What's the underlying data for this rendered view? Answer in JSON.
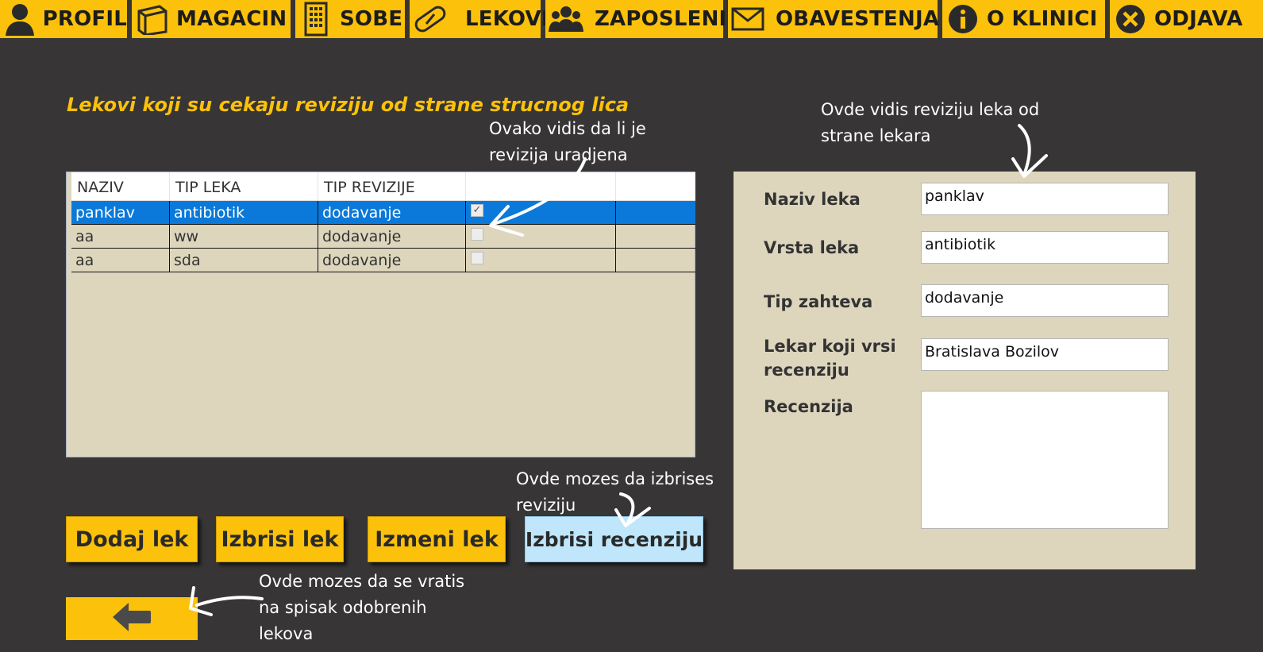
{
  "nav": {
    "items": [
      {
        "label": "PROFIL",
        "icon": "person-icon"
      },
      {
        "label": "MAGACIN",
        "icon": "box-icon"
      },
      {
        "label": "SOBE",
        "icon": "building-icon"
      },
      {
        "label": "LEKOVI",
        "icon": "pill-icon"
      },
      {
        "label": "ZAPOSLENI",
        "icon": "people-icon"
      },
      {
        "label": "OBAVESTENJA",
        "icon": "envelope-icon"
      },
      {
        "label": "O KLINICI",
        "icon": "info-icon"
      },
      {
        "label": "ODJAVA",
        "icon": "close-circle-icon"
      }
    ],
    "accent": "#fcc10a"
  },
  "main": {
    "title": "Lekovi koji su cekaju reviziju od strane strucnog lica"
  },
  "table": {
    "columns": [
      "NAZIV",
      "TIP LEKA",
      "TIP REVIZIJE",
      ""
    ],
    "rows": [
      {
        "naziv": "panklav",
        "tip_leka": "antibiotik",
        "tip_revizije": "dodavanje",
        "checked": true,
        "selected": true
      },
      {
        "naziv": "aa",
        "tip_leka": "ww",
        "tip_revizije": "dodavanje",
        "checked": false,
        "selected": false
      },
      {
        "naziv": "aa",
        "tip_leka": "sda",
        "tip_revizije": "dodavanje",
        "checked": false,
        "selected": false
      }
    ],
    "selection_color": "#0a79d9"
  },
  "buttons": {
    "add": "Dodaj lek",
    "delete": "Izbrisi lek",
    "edit": "Izmeni lek",
    "delete_review": "Izbrisi recenziju"
  },
  "details": {
    "naziv_label": "Naziv leka",
    "naziv_value": "panklav",
    "vrsta_label": "Vrsta leka",
    "vrsta_value": "antibiotik",
    "tip_label": "Tip zahteva",
    "tip_value": "dodavanje",
    "lekar_label_1": "Lekar koji vrsi",
    "lekar_label_2": "recenziju",
    "lekar_value": "Bratislava Bozilov",
    "recenzija_label": "Recenzija",
    "recenzija_value": ""
  },
  "notes": {
    "checkbox_1": "Ovako vidis da li je",
    "checkbox_2": "revizija uradjena",
    "review_1": "Ovde vidis reviziju leka od",
    "review_2": "strane lekara",
    "delete_1": "Ovde mozes da izbrises",
    "delete_2": "reviziju",
    "back_1": "Ovde mozes da se vratis",
    "back_2": "na spisak odobrenih",
    "back_3": "lekova"
  }
}
